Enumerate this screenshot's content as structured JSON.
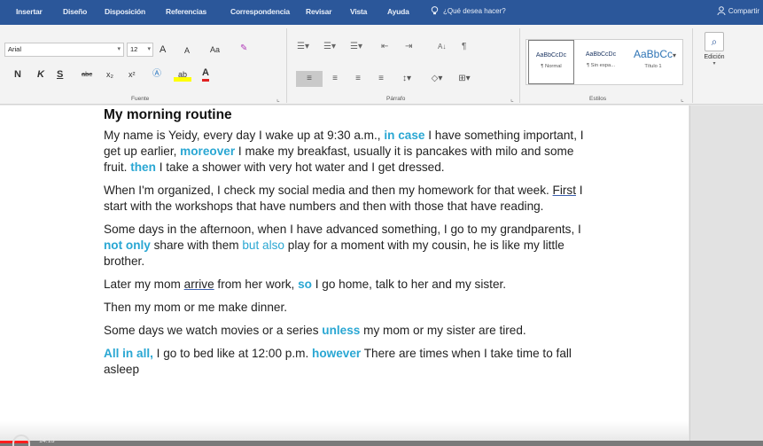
{
  "ribbon_tabs": [
    "Insertar",
    "Diseño",
    "Disposición",
    "Referencias",
    "Correspondencia",
    "Revisar",
    "Vista",
    "Ayuda"
  ],
  "tell_me": "¿Qué desea hacer?",
  "share": "Compartir",
  "font": {
    "name": "Arial",
    "size": "12",
    "grow_label": "A",
    "shrink_label": "A",
    "case_label": "Aa",
    "bold": "N",
    "italic": "K",
    "underline": "S",
    "strike": "abc",
    "subscript": "x₂",
    "superscript": "x²",
    "color_label": "A",
    "group_label": "Fuente"
  },
  "paragraph": {
    "group_label": "Párrafo",
    "sort": "A↓",
    "pilcrow": "¶"
  },
  "styles": {
    "items": [
      {
        "preview": "AaBbCcDc",
        "name": "¶ Normal"
      },
      {
        "preview": "AaBbCcDc",
        "name": "¶ Sin espa..."
      },
      {
        "preview": "AaBbCc",
        "name": "Título 1"
      }
    ],
    "group_label": "Estilos"
  },
  "editing": {
    "label": "Edición"
  },
  "document": {
    "title": "My morning routine",
    "paragraphs": [
      [
        {
          "t": "My name is Yeidy, every day I wake up at 9:30 a.m., "
        },
        {
          "t": "in case",
          "s": "hl"
        },
        {
          "t": " I have something important, I get up earlier, "
        },
        {
          "t": "moreover",
          "s": "hl"
        },
        {
          "t": " I make my breakfast, usually it is pancakes with milo and some fruit. "
        },
        {
          "t": "then",
          "s": "hl"
        },
        {
          "t": " I take a shower with very hot water and I get dressed."
        }
      ],
      [
        {
          "t": "When I'm organized, I check my social media and then my homework for that week. "
        },
        {
          "t": "First",
          "s": "ul"
        },
        {
          "t": " I start with the workshops that have numbers and then with those that have reading."
        }
      ],
      [
        {
          "t": "Some days in the afternoon, when I have advanced something, I go to my grandparents, I "
        },
        {
          "t": "not only",
          "s": "hl"
        },
        {
          "t": " share with them "
        },
        {
          "t": "but also",
          "s": "hl2"
        },
        {
          "t": " play for a moment with my cousin, he is like my little brother."
        }
      ],
      [
        {
          "t": "Later my mom "
        },
        {
          "t": "arrive",
          "s": "ul"
        },
        {
          "t": " from her work, "
        },
        {
          "t": "so",
          "s": "hl"
        },
        {
          "t": " I go home, talk to her and my sister."
        }
      ],
      [
        {
          "t": "Then my mom or me make dinner."
        }
      ],
      [
        {
          "t": "Some days we watch movies or a series "
        },
        {
          "t": "unless",
          "s": "hl"
        },
        {
          "t": " my mom or my sister are tired."
        }
      ],
      [
        {
          "t": "All in all,",
          "s": "hl"
        },
        {
          "t": " I go to bed like at 12:00 p.m. "
        },
        {
          "t": "however",
          "s": "hl"
        },
        {
          "t": " There are times when I take time to fall asleep"
        }
      ]
    ]
  },
  "video": {
    "label": "14:13"
  },
  "colors": {
    "ribbon_blue": "#2b579a",
    "highlight": "#2aa7d3"
  }
}
